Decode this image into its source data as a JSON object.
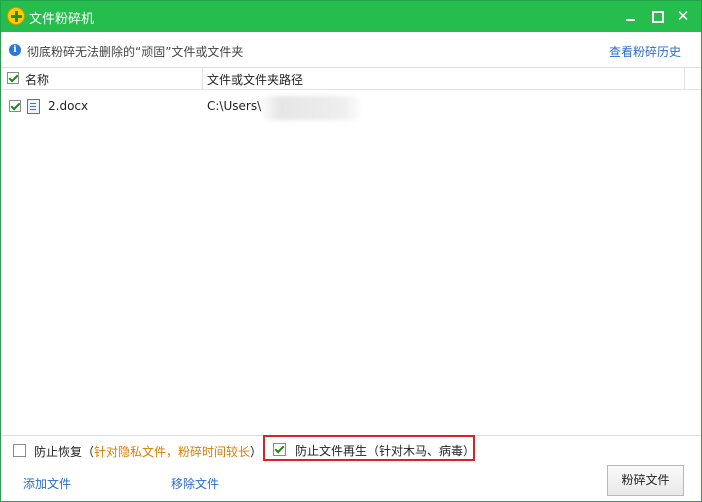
{
  "window": {
    "title": "文件粉碎机"
  },
  "titlebar": {
    "close_glyph": "✕"
  },
  "info": {
    "text": "彻底粉碎无法删除的“顽固”文件或文件夹",
    "history_link": "查看粉碎历史"
  },
  "table": {
    "columns": {
      "name": "名称",
      "path": "文件或文件夹路径"
    },
    "select_all_checked": true,
    "rows": [
      {
        "checked": true,
        "name": "2.docx",
        "path": "C:\\Users\\"
      }
    ]
  },
  "options": {
    "prevent_restore": {
      "checked": false,
      "label": "防止恢复（",
      "note": "针对隐私文件，粉碎时间较长",
      "close": "）"
    },
    "prevent_regen": {
      "checked": true,
      "label": "防止文件再生（针对木马、病毒）"
    }
  },
  "actions": {
    "add_file": "添加文件",
    "remove_file": "移除文件",
    "shred_button": "粉碎文件"
  },
  "colors": {
    "titlebar": "#25be4c",
    "link": "#2a6ad8",
    "note": "#e07a00",
    "highlight": "#e02020"
  }
}
